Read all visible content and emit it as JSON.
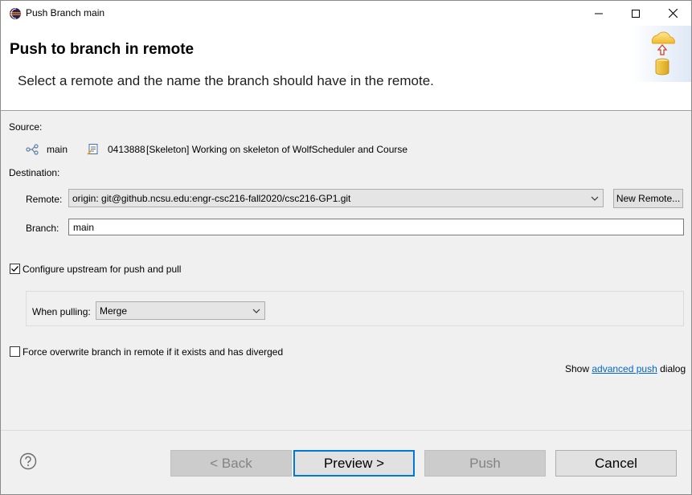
{
  "window": {
    "title": "Push Branch main",
    "app_icon": "eclipse-icon"
  },
  "header": {
    "title": "Push to branch in remote",
    "message": "Select a remote and the name the branch should have in the remote.",
    "graphic": "cloud-push-database-icon"
  },
  "source": {
    "label": "Source:",
    "branch_icon": "git-branch-icon",
    "branch": "main",
    "commit_icon": "git-commit-icon",
    "commit_id": "0413888",
    "commit_message": "[Skeleton] Working on skeleton of WolfScheduler and Course"
  },
  "destination": {
    "label": "Destination:",
    "remote_label": "Remote:",
    "remote_value": "origin: git@github.ncsu.edu:engr-csc216-fall2020/csc216-GP1.git",
    "new_remote_button": "New Remote...",
    "branch_label": "Branch:",
    "branch_value": "main"
  },
  "options": {
    "configure_upstream_label": "Configure upstream for push and pull",
    "configure_upstream_checked": true,
    "when_pulling_label": "When pulling:",
    "when_pulling_value": "Merge",
    "force_overwrite_label": "Force overwrite branch in remote if it exists and has diverged",
    "force_overwrite_checked": false
  },
  "advanced": {
    "prefix": "Show ",
    "link": "advanced push",
    "suffix": " dialog"
  },
  "footer": {
    "back_label": "< Back",
    "preview_label": "Preview >",
    "push_label": "Push",
    "cancel_label": "Cancel"
  }
}
